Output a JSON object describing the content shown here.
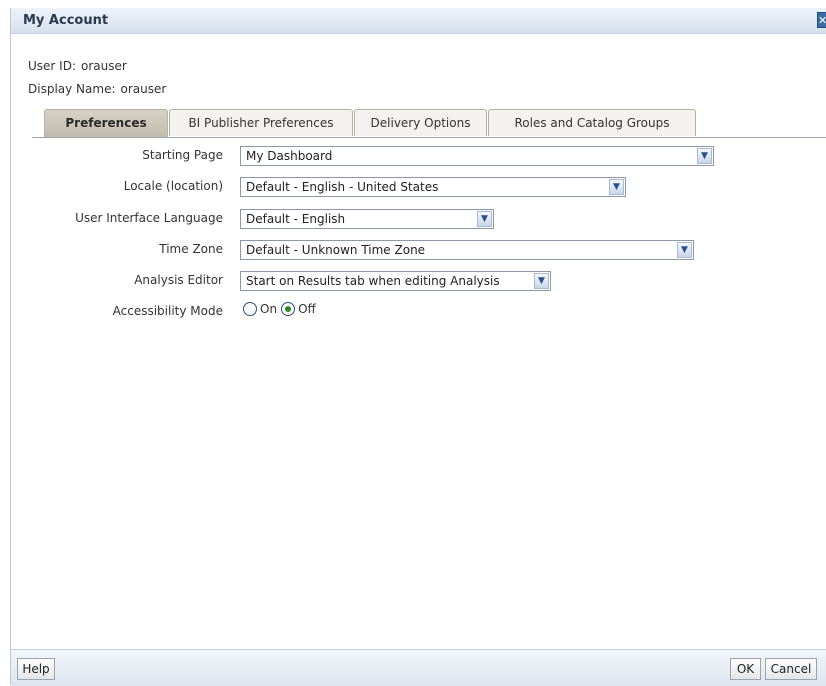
{
  "window": {
    "title": "My Account"
  },
  "user": {
    "id_label": "User ID:",
    "id_value": "orauser",
    "display_label": "Display Name:",
    "display_value": "orauser"
  },
  "tabs": [
    {
      "label": "Preferences",
      "active": true
    },
    {
      "label": "BI Publisher Preferences",
      "active": false
    },
    {
      "label": "Delivery Options",
      "active": false
    },
    {
      "label": "Roles and Catalog Groups",
      "active": false
    }
  ],
  "preferences": {
    "starting_page": {
      "label": "Starting Page",
      "value": "My Dashboard"
    },
    "locale": {
      "label": "Locale (location)",
      "value": "Default - English - United States"
    },
    "ui_language": {
      "label": "User Interface Language",
      "value": "Default - English"
    },
    "time_zone": {
      "label": "Time Zone",
      "value": "Default - Unknown Time Zone"
    },
    "analysis_editor": {
      "label": "Analysis Editor",
      "value": "Start on Results tab when editing Analysis"
    },
    "accessibility": {
      "label": "Accessibility Mode",
      "on_label": "On",
      "off_label": "Off",
      "selected": "Off"
    }
  },
  "footer": {
    "help": "Help",
    "ok": "OK",
    "cancel": "Cancel"
  },
  "icons": {
    "close": "close-icon",
    "dropdown": "chevron-down-icon"
  },
  "colors": {
    "title_bg": "#d6e0ed",
    "active_tab": "#c2bbae",
    "radio_checked": "#2a8a2a"
  }
}
